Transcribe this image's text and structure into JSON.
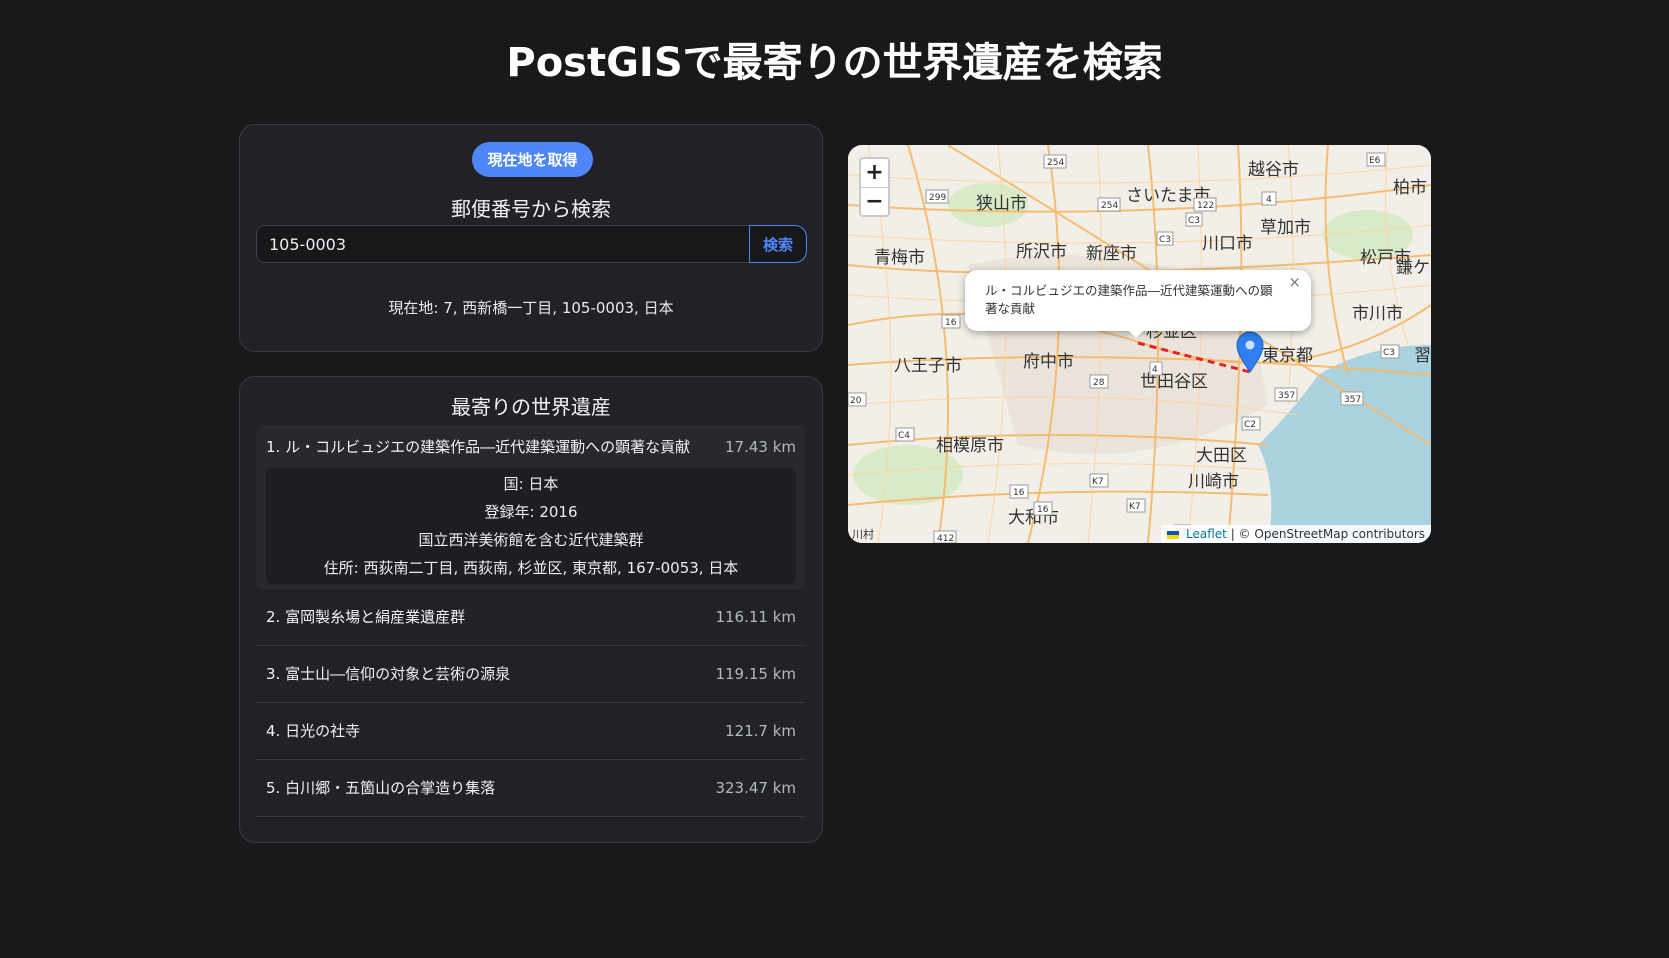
{
  "page": {
    "title": "PostGISで最寄りの世界遺産を検索"
  },
  "search": {
    "locate_button": "現在地を取得",
    "zip_label": "郵便番号から検索",
    "zip_value": "105-0003",
    "search_button": "検索",
    "current_location": "現在地: 7, 西新橋一丁目, 105-0003, 日本"
  },
  "results": {
    "title": "最寄りの世界遺産",
    "items": [
      {
        "name": "1. ル・コルビュジエの建築作品―近代建築運動への顕著な貢献",
        "distance": "17.43 km",
        "country": "国: 日本",
        "year": "登録年: 2016",
        "subtitle": "国立西洋美術館を含む近代建築群",
        "address": "住所: 西荻南二丁目, 西荻南, 杉並区, 東京都, 167-0053, 日本"
      },
      {
        "name": "2. 富岡製糸場と絹産業遺産群",
        "distance": "116.11 km"
      },
      {
        "name": "3. 富士山―信仰の対象と芸術の源泉",
        "distance": "119.15 km"
      },
      {
        "name": "4. 日光の社寺",
        "distance": "121.7 km"
      },
      {
        "name": "5. 白川郷・五箇山の合掌造り集落",
        "distance": "323.47 km"
      }
    ]
  },
  "map": {
    "zoom_in": "+",
    "zoom_out": "−",
    "popup_text": "ル・コルビュジエの建築作品―近代建築運動への顕著な貢献",
    "popup_close": "×",
    "attribution_link": "Leaflet",
    "attribution_text": "| © OpenStreetMap contributors",
    "place_labels": [
      "越谷市",
      "さいたま市",
      "狭山市",
      "草加市",
      "柏市",
      "所沢市",
      "新座市",
      "川口市",
      "青梅市",
      "松戸市",
      "鎌ケ",
      "市川市",
      "杉並区",
      "八王子市",
      "府中市",
      "東京都",
      "世田谷区",
      "相模原市",
      "大田区",
      "川崎市",
      "大和市",
      "習",
      "川村"
    ],
    "road_labels": [
      "254",
      "299",
      "254",
      "122",
      "4",
      "E6",
      "C3",
      "C3",
      "16",
      "20",
      "4",
      "357",
      "357",
      "C2",
      "C4",
      "C3",
      "16",
      "K7",
      "16",
      "K7",
      "K1",
      "412",
      "28"
    ],
    "colors": {
      "accent": "#4f86f7",
      "route": "#e0242b",
      "water": "#aad3df"
    }
  }
}
